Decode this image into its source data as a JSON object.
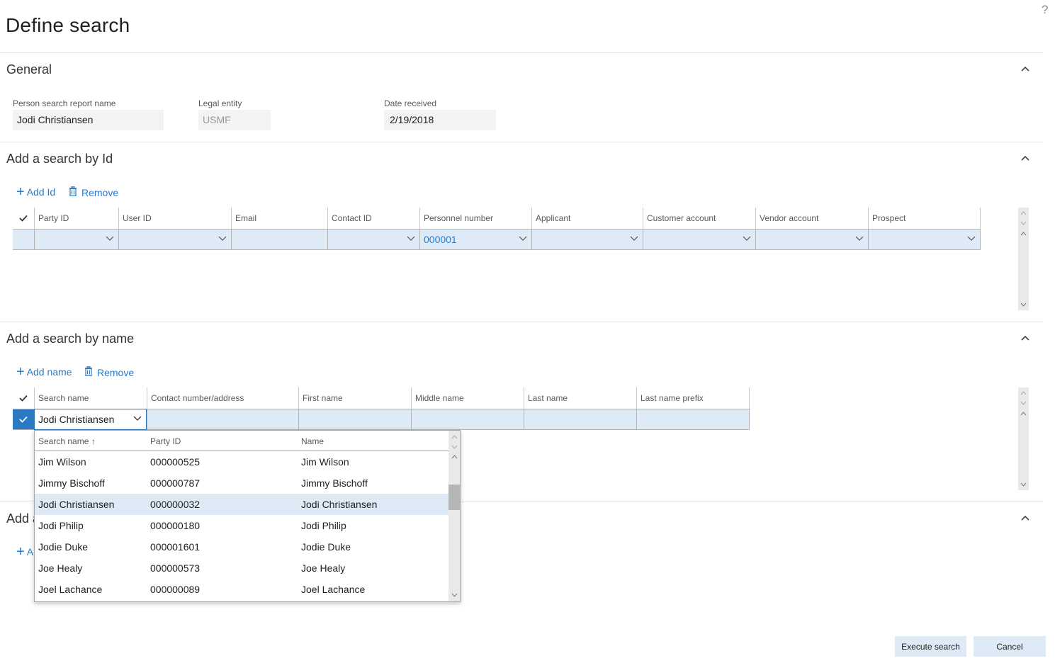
{
  "page": {
    "title": "Define search",
    "help_icon": "question-mark-icon"
  },
  "general": {
    "title": "General",
    "fields": [
      {
        "label": "Person search report name",
        "value": "Jodi Christiansen",
        "readonly": false
      },
      {
        "label": "Legal entity",
        "value": "USMF",
        "readonly": true
      },
      {
        "label": "Date received",
        "value": "2/19/2018",
        "readonly": false
      }
    ]
  },
  "search_by_id": {
    "title": "Add a search by Id",
    "add_label": "Add Id",
    "remove_label": "Remove",
    "columns": [
      "Party ID",
      "User ID",
      "Email",
      "Contact ID",
      "Personnel number",
      "Applicant",
      "Customer account",
      "Vendor account",
      "Prospect"
    ],
    "row": [
      "",
      "",
      "",
      "",
      "000001",
      "",
      "",
      "",
      ""
    ]
  },
  "search_by_name": {
    "title": "Add a search by name",
    "add_label": "Add name",
    "remove_label": "Remove",
    "columns": [
      "Search name",
      "Contact number/address",
      "First name",
      "Middle name",
      "Last name",
      "Last name prefix"
    ],
    "row": [
      "Jodi Christiansen",
      "",
      "",
      "",
      "",
      ""
    ],
    "row_selected": true
  },
  "collapsed_section": {
    "title_partial": "Add a",
    "add_label_partial": "A"
  },
  "lookup": {
    "columns": [
      "Search name",
      "Party ID",
      "Name"
    ],
    "sort_indicator": "↑",
    "rows": [
      {
        "search_name": "Jim Wilson",
        "party_id": "000000525",
        "name": "Jim Wilson",
        "selected": false
      },
      {
        "search_name": "Jimmy Bischoff",
        "party_id": "000000787",
        "name": "Jimmy Bischoff",
        "selected": false
      },
      {
        "search_name": "Jodi Christiansen",
        "party_id": "000000032",
        "name": "Jodi Christiansen",
        "selected": true
      },
      {
        "search_name": "Jodi Philip",
        "party_id": "000000180",
        "name": "Jodi Philip",
        "selected": false
      },
      {
        "search_name": "Jodie Duke",
        "party_id": "000001601",
        "name": "Jodie Duke",
        "selected": false
      },
      {
        "search_name": "Joe Healy",
        "party_id": "000000573",
        "name": "Joe Healy",
        "selected": false
      },
      {
        "search_name": "Joel Lachance",
        "party_id": "000000089",
        "name": "Joel Lachance",
        "selected": false
      }
    ]
  },
  "footer": {
    "execute_label": "Execute search",
    "cancel_label": "Cancel"
  },
  "colors": {
    "accent": "#2b79c2",
    "row_highlight": "#deebf7",
    "input_bg": "#f3f3f3"
  }
}
